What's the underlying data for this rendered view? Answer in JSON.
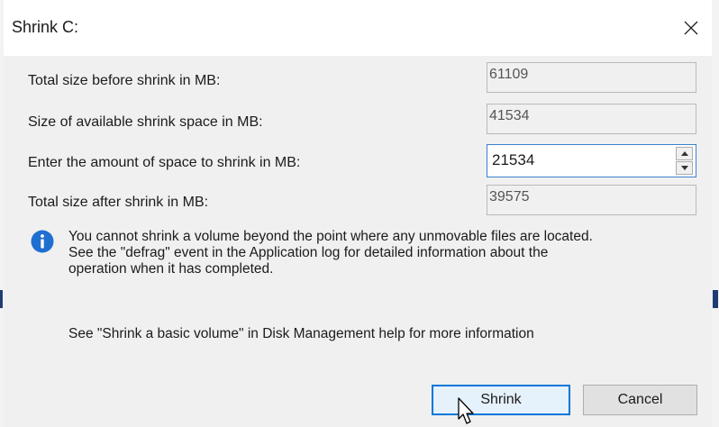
{
  "dialog": {
    "title": "Shrink C:",
    "close_icon": "close-icon"
  },
  "fields": {
    "total_before_label": "Total size before shrink in MB:",
    "total_before_value": "61109",
    "available_label": "Size of available shrink space in MB:",
    "available_value": "41534",
    "amount_label": "Enter the amount of space to shrink in MB:",
    "amount_value": "21534",
    "total_after_label": "Total size after shrink in MB:",
    "total_after_value": "39575"
  },
  "info": {
    "icon": "info-icon",
    "line1": "You cannot shrink a volume beyond the point where any unmovable files are located.",
    "line2": "See the \"defrag\" event in the Application log for detailed information about the",
    "line3": "operation when it has completed."
  },
  "help": {
    "text": "See \"Shrink a basic volume\" in Disk Management help for more information"
  },
  "buttons": {
    "shrink_label": "Shrink",
    "cancel_label": "Cancel"
  },
  "colors": {
    "accent": "#0078d7",
    "info_icon": "#1f6fd1",
    "dialog_bg": "#f0f0f0"
  }
}
